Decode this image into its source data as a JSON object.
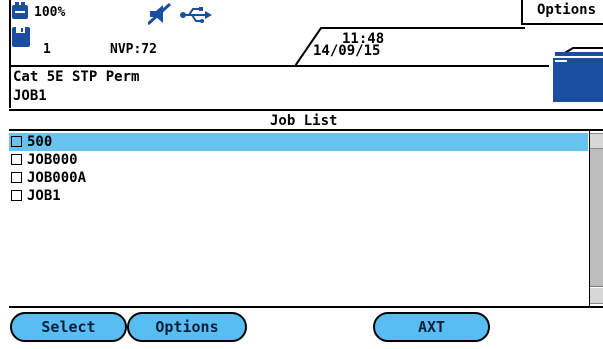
{
  "status": {
    "battery": "100%",
    "jobs_count": "1",
    "nvp": "NVP:72",
    "time": "11:48",
    "date": "14/09/15",
    "options_tab": "Options",
    "icons": [
      "battery-icon",
      "mute-icon",
      "usb-icon",
      "floppy-icon",
      "folder-icon"
    ]
  },
  "test": {
    "cable": "Cat 5E STP Perm",
    "job": "JOB1"
  },
  "job_list": {
    "title": "Job List",
    "items": [
      {
        "label": "500",
        "selected": true
      },
      {
        "label": "JOB000",
        "selected": false
      },
      {
        "label": "JOB000A",
        "selected": false
      },
      {
        "label": "JOB1",
        "selected": false
      }
    ]
  },
  "softkeys": {
    "select": "Select",
    "options": "Options",
    "axt": "AXT"
  },
  "colors": {
    "selection": "#69c3ee",
    "softkey": "#58bdf0",
    "icon_blue": "#1a4e9e"
  }
}
